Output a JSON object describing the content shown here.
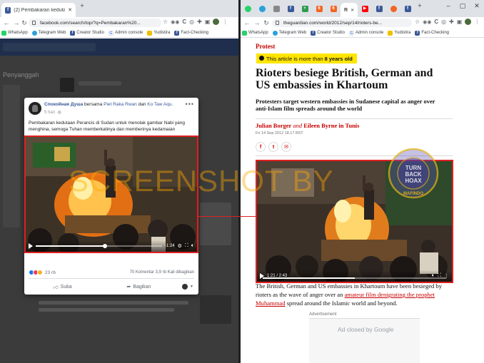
{
  "left_window": {
    "tab_title": "(2) Pembakaran kedutaan Peranc",
    "url": "facebook.com/search/top/?q=Pembakaran%20...",
    "bookmarks": [
      "WhatsApp",
      "Telegram Web",
      "Creator Studio",
      "Admin console",
      "Yudistira",
      "Fact-Checking"
    ],
    "page": {
      "partial_text": "Penyanggah"
    }
  },
  "fb_post": {
    "author": "Спокойная Душа",
    "with_text": "bersama",
    "tagged_1": "Piet Raka Rwan",
    "and_text": "dan",
    "tagged_2": "Ko Taw Aqu.",
    "time": "5 hari",
    "caption": "Pembakaran kedutaan Perancis di Sudan untuk menolak gambar Nabi yang menghina, semoga Tuhan memberkatinya dan memberinya kedamaian",
    "video_time": "-1:24",
    "video_progress": 0.55,
    "reactions_count": "23 rb",
    "comments": "70 Komentar",
    "shares": "3,9 rb Kali dibagikan",
    "like_label": "Suka",
    "share_label": "Bagikan"
  },
  "right_window": {
    "tab_label": "R",
    "url": "theguardian.com/world/2012/sep/14/rioters-be...",
    "bookmarks": [
      "WhatsApp",
      "Telegram Web",
      "Creator Studio",
      "Admin console",
      "Yudistira",
      "Fact-Checking"
    ]
  },
  "guardian": {
    "section": "Protest",
    "age_notice_prefix": "This article is more than",
    "age_notice_bold": "8 years old",
    "headline": "Rioters besiege British, German and US embassies in Khartoum",
    "standfirst": "Protesters target western embassies in Sudanese capital as anger over anti-Islam film spreads around the world",
    "author_1": "Julian Borger",
    "author_and": "and",
    "author_2": "Eileen Byrne in Tunis",
    "date": "Fri 14 Sep 2012 18.17 BST",
    "video_time": "1:21 / 2:43",
    "video_progress": 0.5,
    "body_before": "The British, German and US embassies in Khartoum have been besieged by rioters as the wave of anger over an",
    "body_link": "amateur film denigrating the prophet Muhammad",
    "body_after": "spread around the Islamic world and beyond.",
    "ad_label": "Advertisement",
    "ad_closed_prefix": "Ad closed by",
    "ad_closed_brand": "Google"
  },
  "watermark": "SCREENSHOT BY",
  "stamp": {
    "ring_text": "MASYARAKAT ANTI FITNAH INDONESIA",
    "center_text_1": "TURN",
    "center_text_2": "BACK",
    "center_text_3": "HOAX",
    "bottom_text": "MAFINDO"
  },
  "colors": {
    "guardian_red": "#c70000",
    "highlight_red": "#e02020",
    "notice_yellow": "#ffe500",
    "fb_link": "#385898",
    "watermark": "#ffaa00"
  }
}
